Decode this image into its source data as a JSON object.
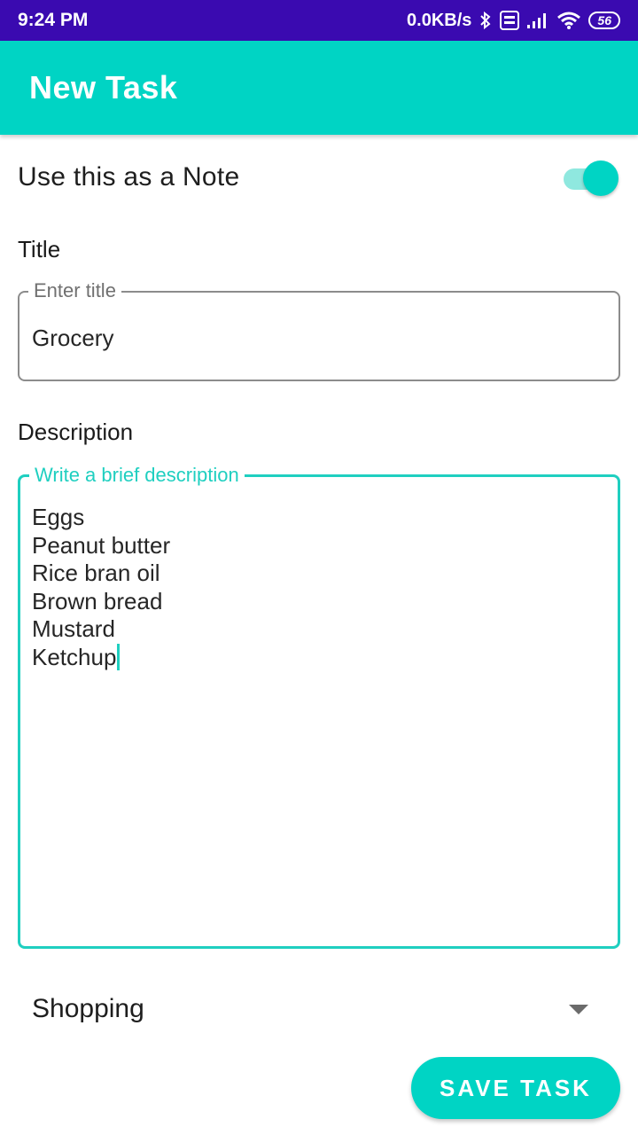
{
  "status_bar": {
    "time": "9:24 PM",
    "net_speed": "0.0KB/s",
    "battery": "56",
    "icons": [
      "bluetooth-icon",
      "volte-icon",
      "signal-icon",
      "wifi-icon",
      "battery-icon"
    ]
  },
  "app_bar": {
    "title": "New Task"
  },
  "note_toggle": {
    "label": "Use this as a Note",
    "checked": true
  },
  "title_section": {
    "label": "Title",
    "placeholder": "Enter title",
    "value": "Grocery"
  },
  "description_section": {
    "label": "Description",
    "placeholder": "Write a brief description",
    "lines": [
      "Eggs",
      "Peanut butter",
      "Rice bran oil",
      "Brown bread",
      "Mustard",
      "Ketchup"
    ]
  },
  "category": {
    "selected": "Shopping"
  },
  "save_button": {
    "label": "SAVE TASK"
  },
  "colors": {
    "accent": "#00d4c4",
    "status_bar": "#3a0ab0",
    "focused_outline": "#1fcfc0"
  }
}
